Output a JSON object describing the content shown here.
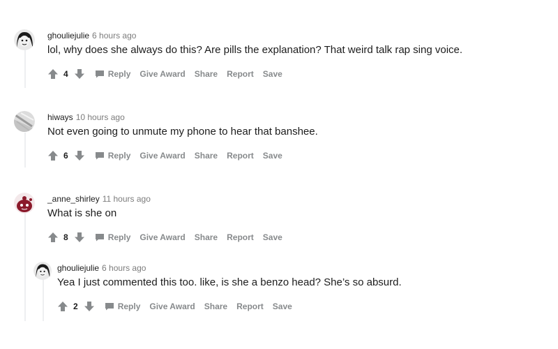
{
  "comments": [
    {
      "username": "ghouliejulie",
      "timestamp": "6 hours ago",
      "body": "lol, why does she always do this? Are pills the explanation? That weird talk rap sing voice.",
      "score": "4",
      "avatar": "avatar-dark-hair-icon"
    },
    {
      "username": "hiways",
      "timestamp": "10 hours ago",
      "body": "Not even going to unmute my phone to hear that banshee.",
      "score": "6",
      "avatar": "avatar-gray-photo-icon"
    },
    {
      "username": "_anne_shirley",
      "timestamp": "11 hours ago",
      "body": "What is she on",
      "score": "8",
      "avatar": "avatar-red-snoo-icon"
    },
    {
      "username": "ghouliejulie",
      "timestamp": "6 hours ago",
      "body": "Yea I just commented this too. like, is she a benzo head? She’s so absurd.",
      "score": "2",
      "avatar": "avatar-dark-hair-icon"
    }
  ],
  "actions": {
    "reply": "Reply",
    "give_award": "Give Award",
    "share": "Share",
    "report": "Report",
    "save": "Save"
  },
  "colors": {
    "text": "#1c1c1c",
    "meta": "#7c7c7c",
    "action": "#878a8c",
    "thread_line": "#edeff1"
  }
}
